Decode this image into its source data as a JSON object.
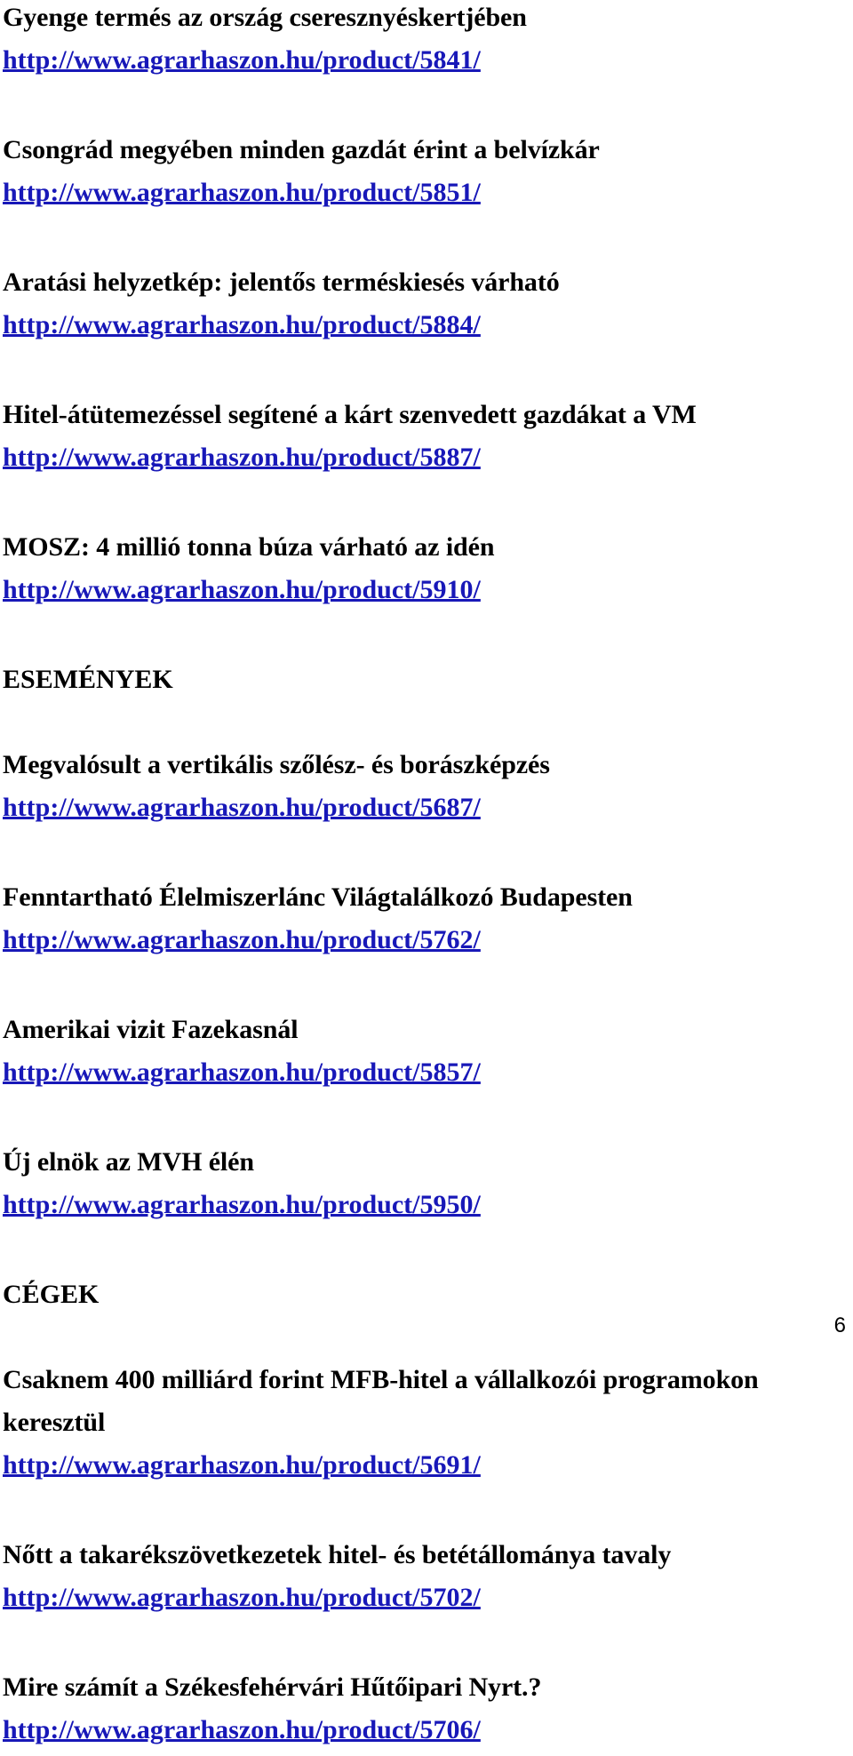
{
  "document": {
    "page_number": "6",
    "link_color": "#1818B8",
    "text_color": "#000000",
    "background_color": "#FFFFFF"
  },
  "sections": [
    {
      "heading": null,
      "entries": [
        {
          "title": "Gyenge termés az ország cseresznyéskertjében",
          "url": "http://www.agrarhaszon.hu/product/5841/"
        },
        {
          "title": "Csongrád megyében minden gazdát érint a belvízkár",
          "url": "http://www.agrarhaszon.hu/product/5851/"
        },
        {
          "title": "Aratási helyzetkép: jelentős terméskiesés várható",
          "url": "http://www.agrarhaszon.hu/product/5884/"
        },
        {
          "title": "Hitel-átütemezéssel segítené a kárt szenvedett gazdákat a VM",
          "url": "http://www.agrarhaszon.hu/product/5887/"
        },
        {
          "title": "MOSZ: 4 millió tonna búza várható az idén",
          "url": "http://www.agrarhaszon.hu/product/5910/"
        }
      ]
    },
    {
      "heading": "ESEMÉNYEK",
      "entries": [
        {
          "title": "Megvalósult a vertikális szőlész- és borászképzés",
          "url": "http://www.agrarhaszon.hu/product/5687/"
        },
        {
          "title": "Fenntartható Élelmiszerlánc Világtalálkozó Budapesten",
          "url": "http://www.agrarhaszon.hu/product/5762/"
        },
        {
          "title": "Amerikai vizit Fazekasnál",
          "url": "http://www.agrarhaszon.hu/product/5857/"
        },
        {
          "title": "Új elnök az MVH élén",
          "url": "http://www.agrarhaszon.hu/product/5950/"
        }
      ]
    },
    {
      "heading": "CÉGEK",
      "entries": [
        {
          "title": "Csaknem 400 milliárd forint MFB-hitel a vállalkozói programokon keresztül",
          "url": "http://www.agrarhaszon.hu/product/5691/"
        },
        {
          "title": "Nőtt a takarékszövetkezetek hitel- és betétállománya tavaly",
          "url": "http://www.agrarhaszon.hu/product/5702/"
        },
        {
          "title": "Mire számít a Székesfehérvári Hűtőipari Nyrt.?",
          "url": "http://www.agrarhaszon.hu/product/5706/"
        }
      ]
    }
  ]
}
